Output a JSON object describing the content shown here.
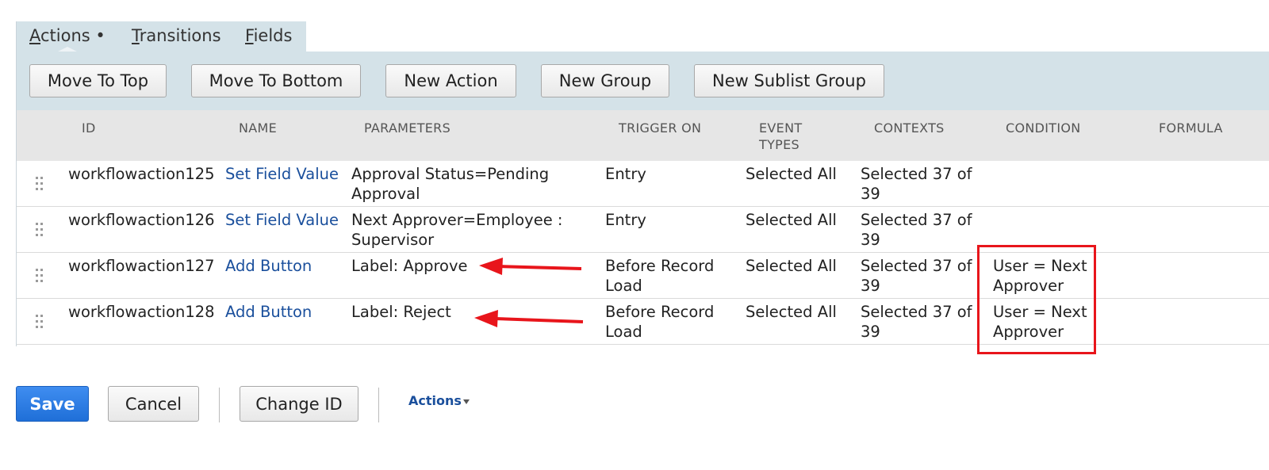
{
  "tabs": [
    {
      "label": "Actions",
      "underline": "A",
      "rest": "ctions",
      "suffix": " •"
    },
    {
      "label": "Transitions",
      "underline": "T",
      "rest": "ransitions"
    },
    {
      "label": "Fields",
      "underline": "F",
      "rest": "ields"
    }
  ],
  "toolbar": {
    "move_top": "Move To Top",
    "move_bottom": "Move To Bottom",
    "new_action": "New Action",
    "new_group": "New Group",
    "new_sublist_group": "New Sublist Group"
  },
  "columns": {
    "id": "ID",
    "name": "NAME",
    "parameters": "PARAMETERS",
    "trigger_on": "TRIGGER ON",
    "event_types_1": "EVENT",
    "event_types_2": "TYPES",
    "contexts": "CONTEXTS",
    "condition": "CONDITION",
    "formula": "FORMULA"
  },
  "rows": [
    {
      "id": "workflowaction125",
      "name": "Set Field Value",
      "param_1": "Approval Status=Pending",
      "param_2": "Approval",
      "trigger_1": "Entry",
      "trigger_2": "",
      "event_types": "Selected All",
      "contexts_1": "Selected 37 of",
      "contexts_2": "39",
      "condition_1": "",
      "condition_2": "",
      "formula": ""
    },
    {
      "id": "workflowaction126",
      "name": "Set Field Value",
      "param_1": "Next Approver=Employee :",
      "param_2": "Supervisor",
      "trigger_1": "Entry",
      "trigger_2": "",
      "event_types": "Selected All",
      "contexts_1": "Selected 37 of",
      "contexts_2": "39",
      "condition_1": "",
      "condition_2": "",
      "formula": ""
    },
    {
      "id": "workflowaction127",
      "name": "Add Button",
      "param_1": "Label: Approve",
      "param_2": "",
      "trigger_1": "Before Record",
      "trigger_2": "Load",
      "event_types": "Selected All",
      "contexts_1": "Selected 37 of",
      "contexts_2": "39",
      "condition_1": "User = Next",
      "condition_2": "Approver",
      "formula": ""
    },
    {
      "id": "workflowaction128",
      "name": "Add Button",
      "param_1": "Label: Reject",
      "param_2": "",
      "trigger_1": "Before Record",
      "trigger_2": "Load",
      "event_types": "Selected All",
      "contexts_1": "Selected 37 of",
      "contexts_2": "39",
      "condition_1": "User = Next",
      "condition_2": "Approver",
      "formula": ""
    }
  ],
  "footer": {
    "save": "Save",
    "cancel": "Cancel",
    "change_id": "Change ID",
    "actions": "Actions"
  },
  "annotation_color": "#e8151b"
}
